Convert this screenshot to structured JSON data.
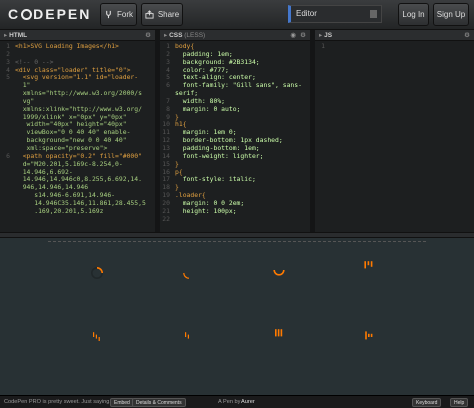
{
  "header": {
    "logo": "CODEPEN",
    "fork_label": "Fork",
    "share_label": "Share",
    "editor_label": "Editor",
    "login_label": "Log In",
    "signup_label": "Sign Up"
  },
  "panes": {
    "html_title": "HTML",
    "css_title": "CSS",
    "css_sub": "(LESS)",
    "js_title": "JS"
  },
  "html_code": [
    "<h1>SVG Loading Images</h1>",
    "",
    "<!-- 0 -->",
    "<div class=\"loader\" title=\"0\">",
    "  <svg version=\"1.1\" id=\"loader-",
    "  1\"",
    "  xmlns=\"http://www.w3.org/2000/s",
    "  vg\"",
    "  xmlns:xlink=\"http://www.w3.org/",
    "  1999/xlink\" x=\"0px\" y=\"0px\"",
    "   width=\"40px\" height=\"40px\"",
    "   viewBox=\"0 0 40 40\" enable-",
    "   background=\"new 0 0 40 40\"",
    "   xml:space=\"preserve\">",
    "  <path opacity=\"0.2\" fill=\"#000\"",
    "  d=\"M20.201,5.169c-8.254,0-",
    "  14.946,6.692-",
    "  14.946,14.946c0,8.255,6.692,14.",
    "  946,14.946,14.946",
    "     s14.946-6.691,14.946-",
    "     14.946C35.146,11.861,28.455,5",
    "     .169,20.201,5.169z",
    "  "
  ],
  "html_line_numbers": [
    "1",
    "2",
    "3",
    "4",
    "5",
    "",
    "",
    "",
    "",
    "",
    "",
    "",
    "",
    "",
    "6",
    "",
    "",
    "",
    "",
    "",
    "",
    "",
    ""
  ],
  "css_code": [
    "body{",
    "  padding: 1em;",
    "  background: #2B3134;",
    "  color: #777;",
    "  text-align: center;",
    "  font-family: \"Gill sans\", sans-",
    "serif;",
    "  width: 80%;",
    "  margin: 0 auto;",
    "}",
    "h1{",
    "  margin: 1em 0;",
    "  border-bottom: 1px dashed;",
    "  padding-bottom: 1em;",
    "  font-weight: lighter;",
    "}",
    "p{",
    "  font-style: italic;",
    "}",
    ".loader{",
    "  margin: 0 0 2em;",
    "  height: 100px;",
    "  "
  ],
  "css_line_numbers": [
    "1",
    "2",
    "3",
    "4",
    "5",
    "6",
    "",
    "7",
    "8",
    "9",
    "10",
    "11",
    "12",
    "13",
    "14",
    "15",
    "16",
    "17",
    "18",
    "19",
    "20",
    "21",
    "22"
  ],
  "js_line_numbers": [
    "1"
  ],
  "footer": {
    "pro_text": "CodePen PRO is pretty sweet. Just saying.",
    "embed_label": "Embed",
    "details_label": "Details & Comments",
    "pen_by": "A Pen by",
    "author": "Aurer",
    "keyboard_label": "Keyboard",
    "help_label": "Help"
  },
  "colors": {
    "accent": "#ff7a00",
    "preview_bg": "#283134",
    "editor_bg": "#1d1f20"
  }
}
